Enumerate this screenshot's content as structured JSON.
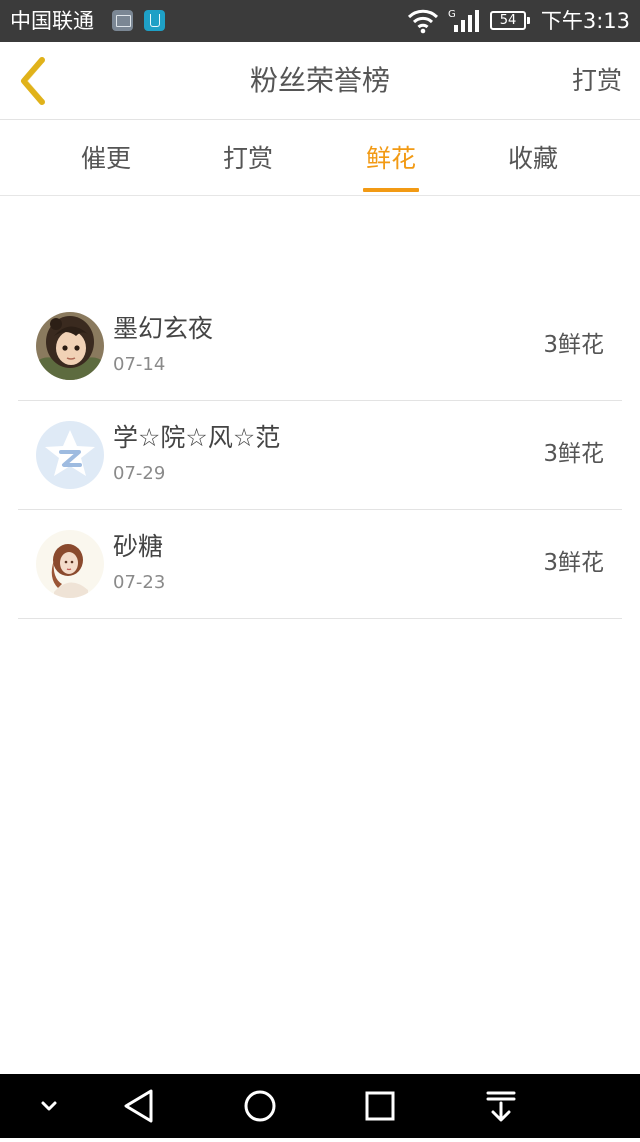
{
  "status_bar": {
    "carrier": "中国联通",
    "signal_type": "G",
    "battery": "54",
    "time": "下午3:13",
    "icons": [
      "gallery-icon",
      "app-icon",
      "wifi-icon",
      "signal-icon",
      "battery-icon"
    ]
  },
  "header": {
    "title": "粉丝荣誉榜",
    "right_action": "打赏",
    "back_icon": "chevron-left-icon"
  },
  "tabs": [
    {
      "label": "催更",
      "active": false
    },
    {
      "label": "打赏",
      "active": false
    },
    {
      "label": "鲜花",
      "active": true
    },
    {
      "label": "收藏",
      "active": false
    }
  ],
  "fans": [
    {
      "name": "墨幻玄夜",
      "date": "07-14",
      "gift": "3鲜花",
      "avatar": "anime-character-avatar"
    },
    {
      "name": "学☆院☆风☆范",
      "date": "07-29",
      "gift": "3鲜花",
      "avatar": "qzone-default-avatar"
    },
    {
      "name": "砂糖",
      "date": "07-23",
      "gift": "3鲜花",
      "avatar": "girl-illustration-avatar"
    }
  ],
  "nav_bar": {
    "icons": [
      "collapse-icon",
      "back-triangle-icon",
      "home-circle-icon",
      "recents-square-icon",
      "notification-pull-icon"
    ]
  },
  "colors": {
    "accent": "#f29a14",
    "back_arrow": "#e0b21a",
    "status_bar": "#3b3b3b",
    "nav_bar": "#000000"
  }
}
